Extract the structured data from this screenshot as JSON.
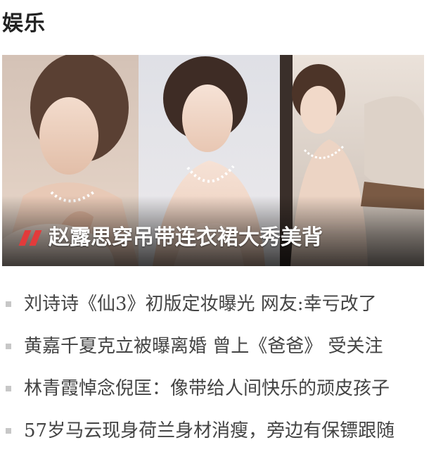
{
  "section": {
    "title": "娱乐"
  },
  "featured": {
    "headline": "赵露思穿吊带连衣裙大秀美背",
    "photos": [
      "featured-photo-left",
      "featured-photo-center",
      "featured-photo-right"
    ],
    "accent_color": "#e23b3b"
  },
  "news": {
    "items": [
      {
        "text": "刘诗诗《仙3》初版定妆曝光 网友:幸亏改了"
      },
      {
        "text": "黄嘉千夏克立被曝离婚 曾上《爸爸》 受关注"
      },
      {
        "text": "林青霞悼念倪匡：像带给人间快乐的顽皮孩子"
      },
      {
        "text": "57岁马云现身荷兰身材消瘦，旁边有保镖跟随"
      }
    ],
    "bullet_color": "#c7c7c7",
    "text_color": "#444444"
  }
}
